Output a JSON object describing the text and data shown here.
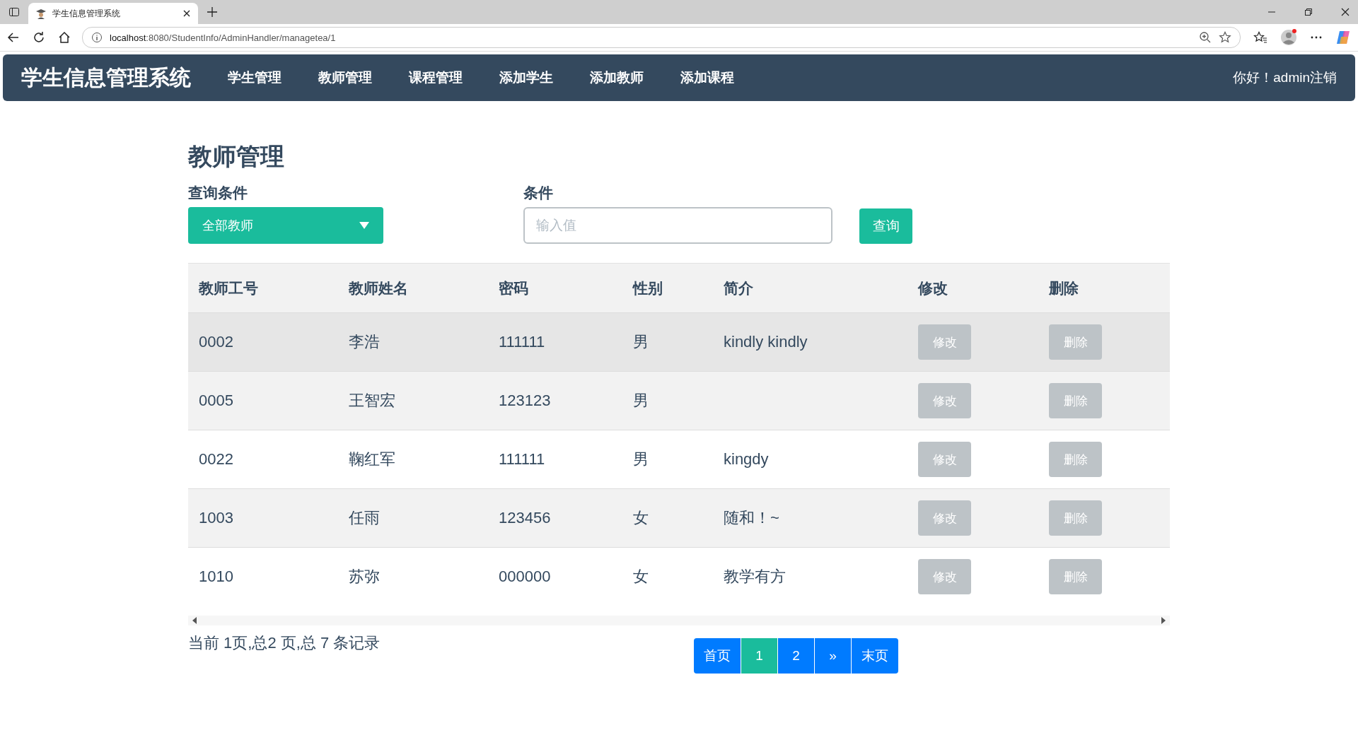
{
  "browser": {
    "tab_title": "学生信息管理系统",
    "url_host": "localhost",
    "url_rest": ":8080/StudentInfo/AdminHandler/managetea/1"
  },
  "navbar": {
    "brand": "学生信息管理系统",
    "items": [
      {
        "label": "学生管理"
      },
      {
        "label": "教师管理"
      },
      {
        "label": "课程管理"
      },
      {
        "label": "添加学生"
      },
      {
        "label": "添加教师"
      },
      {
        "label": "添加课程"
      }
    ],
    "greeting": "你好！admin",
    "logout": "注销"
  },
  "page_title": "教师管理",
  "search": {
    "condition_label": "查询条件",
    "condition_value": "全部教师",
    "value_label": "条件",
    "placeholder": "输入值",
    "button": "查询"
  },
  "table": {
    "columns": [
      "教师工号",
      "教师姓名",
      "密码",
      "性别",
      "简介",
      "修改",
      "删除"
    ],
    "rows": [
      {
        "id": "0002",
        "name": "李浩",
        "password": "111111",
        "gender": "男",
        "intro": "kindly kindly",
        "edit": "修改",
        "delete": "删除",
        "hovered": true
      },
      {
        "id": "0005",
        "name": "王智宏",
        "password": "123123",
        "gender": "男",
        "edit": "修改",
        "delete": "删除",
        "hovered": false
      },
      {
        "id": "0022",
        "name": "鞠红军",
        "password": "111111",
        "gender": "男",
        "intro": "kingdy",
        "edit": "修改",
        "delete": "删除",
        "hovered": false
      },
      {
        "id": "1003",
        "name": "任雨",
        "password": "123456",
        "gender": "女",
        "intro": "随和！~",
        "edit": "修改",
        "delete": "删除",
        "hovered": false
      },
      {
        "id": "1010",
        "name": "苏弥",
        "password": "000000",
        "gender": "女",
        "intro": "教学有方",
        "edit": "修改",
        "delete": "删除",
        "hovered": false
      }
    ]
  },
  "summary": "当前 1页,总2 页,总 7 条记录",
  "pagination": [
    {
      "label": "首页",
      "selected": false
    },
    {
      "label": "1",
      "selected": true
    },
    {
      "label": "2",
      "selected": false
    },
    {
      "label": "»",
      "selected": false
    },
    {
      "label": "末页",
      "selected": false
    }
  ]
}
